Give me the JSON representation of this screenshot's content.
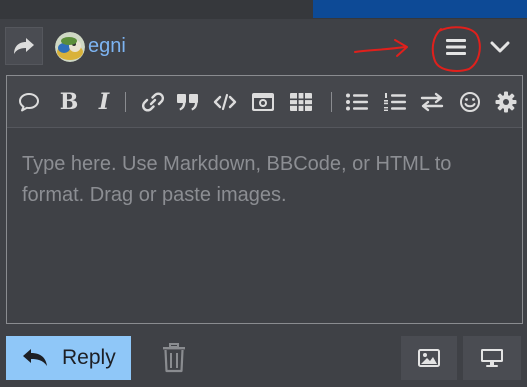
{
  "composer": {
    "username": "egni",
    "placeholder": "Type here. Use Markdown, BBCode, or HTML to format. Drag or paste images.",
    "reply_label": "Reply"
  },
  "toolbar": {
    "buttons": [
      {
        "name": "quote",
        "icon": "speech-bubble-icon"
      },
      {
        "name": "bold",
        "label": "B"
      },
      {
        "name": "italic",
        "label": "I"
      },
      {
        "name": "link",
        "icon": "link-icon"
      },
      {
        "name": "blockquote",
        "icon": "quote-marks-icon"
      },
      {
        "name": "code",
        "icon": "code-icon"
      },
      {
        "name": "image",
        "icon": "camera-icon"
      },
      {
        "name": "table",
        "icon": "table-icon"
      },
      {
        "name": "bullet-list",
        "icon": "bullet-list-icon"
      },
      {
        "name": "numbered-list",
        "icon": "numbered-list-icon"
      },
      {
        "name": "direction",
        "icon": "swap-arrows-icon"
      },
      {
        "name": "emoji",
        "icon": "smiley-icon"
      },
      {
        "name": "options",
        "icon": "gear-icon"
      }
    ]
  },
  "colors": {
    "background": "#3f4146",
    "username": "#7db4f2",
    "reply_button": "#8fc7f8",
    "annotation": "#e0201c",
    "top_accent": "#0d4a96"
  }
}
